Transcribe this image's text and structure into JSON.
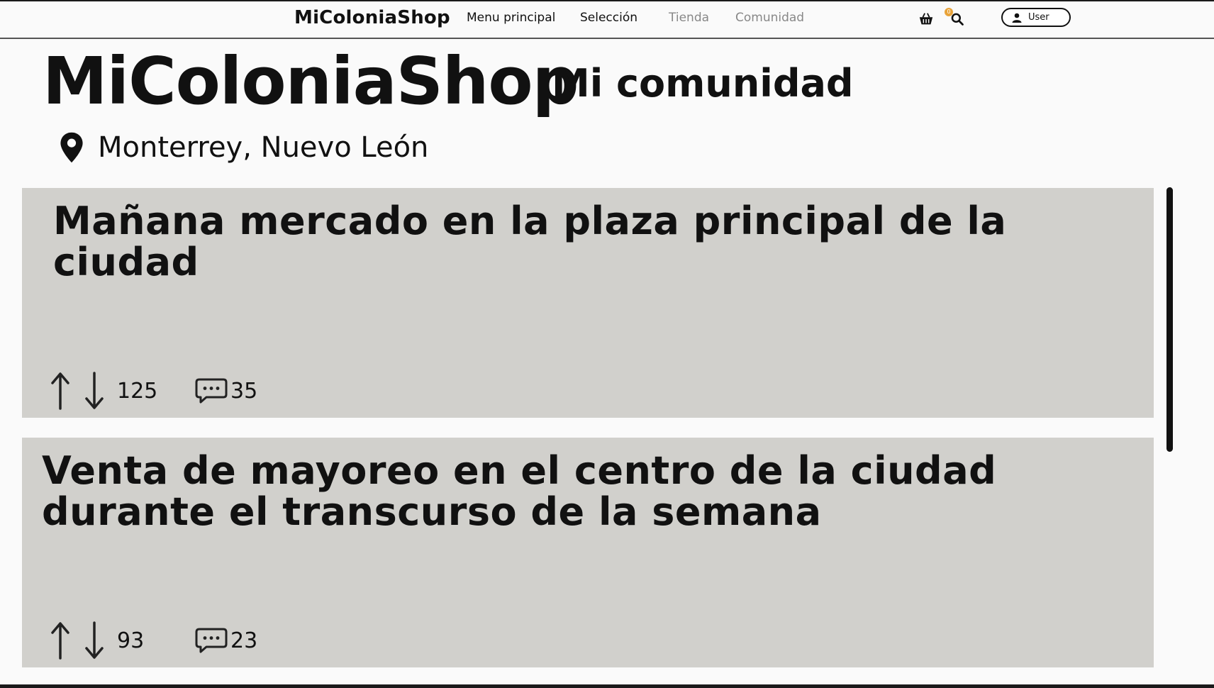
{
  "navbar": {
    "brand": "MiColoniaShop",
    "links": [
      {
        "label": "Menu principal"
      },
      {
        "label": "Selección"
      },
      {
        "label": "Tienda"
      },
      {
        "label": "Comunidad"
      }
    ],
    "cart_icon": "basket-icon",
    "cart_count": "0",
    "search_icon": "search-icon",
    "user_label": "User",
    "user_icon": "user-icon"
  },
  "header": {
    "site_title": "MiColoniaShop",
    "subtitle": "Mi comunidad",
    "location_icon": "map-pin-icon",
    "location": "Monterrey, Nuevo León"
  },
  "posts": [
    {
      "title": "Mañana mercado en la plaza principal de la ciudad",
      "votes": "125",
      "comments": "35"
    },
    {
      "title": "Venta de mayoreo en el centro de la ciudad durante el transcurso de la semana",
      "votes": "93",
      "comments": "23"
    }
  ],
  "colors": {
    "card_bg": "#d1d0cc",
    "page_bg": "#fafafa",
    "badge": "#e8a33a"
  }
}
